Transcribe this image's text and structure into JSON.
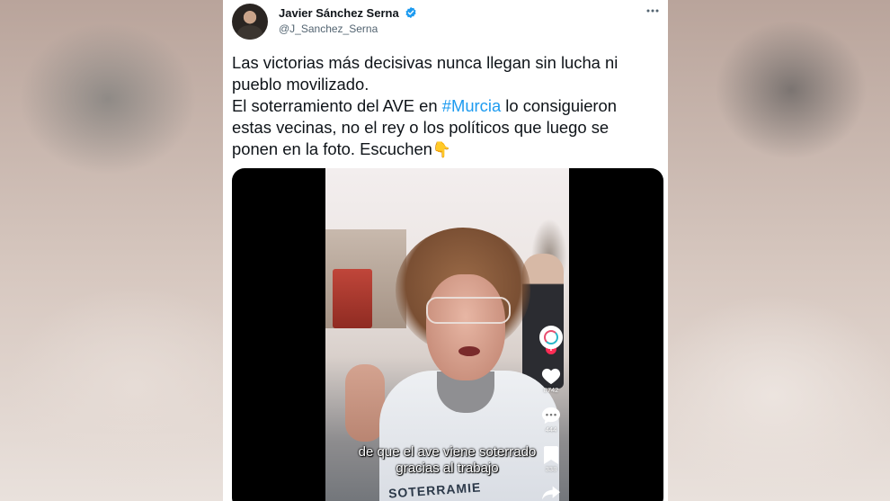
{
  "tweet": {
    "author_name": "Javier Sánchez Serna",
    "handle": "@J_Sanchez_Serna",
    "verified": true,
    "more_icon": "more-horizontal-icon",
    "text_line_1": "Las victorias más decisivas nunca llegan sin lucha ni pueblo movilizado.",
    "text_line_2_before": "El soterramiento del AVE en ",
    "hashtag": "#Murcia",
    "text_line_2_after": " lo consiguieron estas vecinas, no el rey o los políticos que luego se ponen en la foto. Escuchen",
    "emoji": "👇",
    "accent_color": "#1d9bf0"
  },
  "video": {
    "subtitle_line_1": "de que el ave viene soterrado",
    "subtitle_line_2": "gracias al trabajo",
    "shirt_print": "SOTERRAMIE",
    "like_count": "8742",
    "comment_count": "444",
    "bookmark_count": "338",
    "icons": [
      "profile-avatar-icon",
      "heart-icon",
      "comment-icon",
      "bookmark-icon",
      "share-icon"
    ]
  }
}
